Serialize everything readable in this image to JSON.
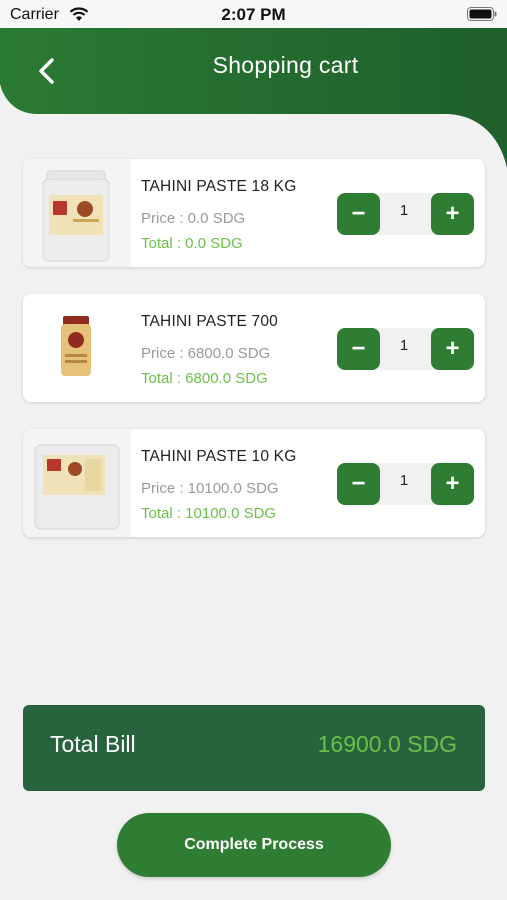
{
  "status_bar": {
    "carrier": "Carrier",
    "time": "2:07 PM"
  },
  "header": {
    "title": "Shopping cart",
    "back_icon": "chevron-left-icon"
  },
  "colors": {
    "primary_green": "#2f7d32",
    "dark_green": "#27633d",
    "light_green_text": "#6cc04a"
  },
  "cart": {
    "items": [
      {
        "name": "TAHINI PASTE 18 KG",
        "price": "Price : 0.0 SDG",
        "total": "Total : 0.0 SDG",
        "quantity": "1",
        "minus": "−",
        "plus": "+"
      },
      {
        "name": "TAHINI PASTE 700",
        "price": "Price : 6800.0 SDG",
        "total": "Total : 6800.0 SDG",
        "quantity": "1",
        "minus": "−",
        "plus": "+"
      },
      {
        "name": "TAHINI PASTE 10 KG",
        "price": "Price : 10100.0 SDG",
        "total": "Total : 10100.0 SDG",
        "quantity": "1",
        "minus": "−",
        "plus": "+"
      }
    ]
  },
  "summary": {
    "label": "Total Bill",
    "value": "16900.0 SDG"
  },
  "actions": {
    "complete_label": "Complete Process"
  }
}
